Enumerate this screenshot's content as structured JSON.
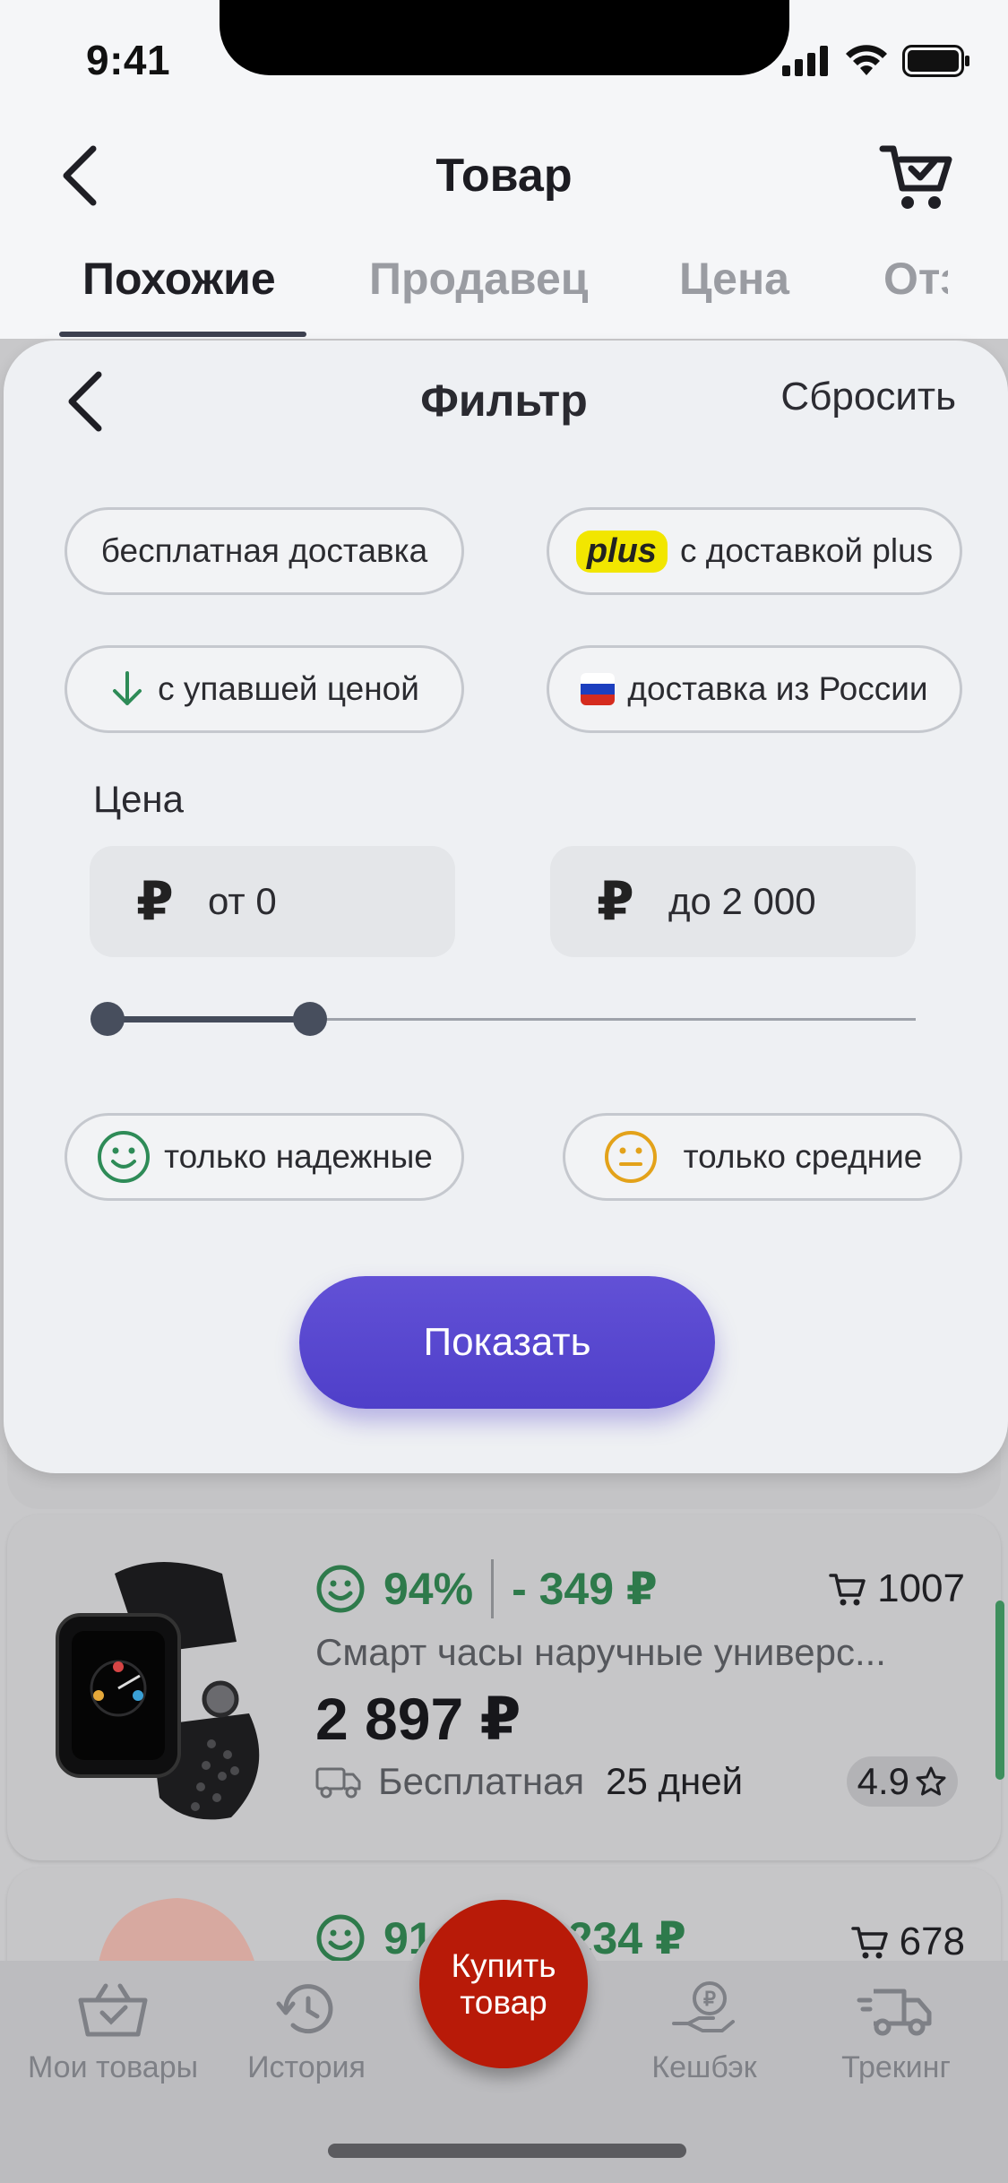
{
  "status_bar": {
    "time": "9:41"
  },
  "header": {
    "title": "Товар"
  },
  "tabs": [
    {
      "label": "Похожие",
      "active": true
    },
    {
      "label": "Продавец",
      "active": false
    },
    {
      "label": "Цена",
      "active": false
    },
    {
      "label": "Отз",
      "active": false
    }
  ],
  "filter": {
    "title": "Фильтр",
    "reset_label": "Сбросить",
    "chips": {
      "free_delivery": "бесплатная доставка",
      "plus_badge": "plus",
      "plus_delivery": "с доставкой plus",
      "price_drop": "с упавшей ценой",
      "from_russia": "доставка из России"
    },
    "price": {
      "label": "Цена",
      "currency": "₽",
      "from": "от 0",
      "to": "до 2 000",
      "slider_min_fraction": 0.0,
      "slider_max_fraction": 0.25
    },
    "reliability": {
      "reliable": "только надежные",
      "average": "только средние"
    },
    "show_button": "Показать"
  },
  "products": [
    {
      "rating_percent": "94%",
      "discount": "- 349 ₽",
      "orders": "1007",
      "name": "Смарт часы наручные универс...",
      "price": "2 897 ₽",
      "delivery": "Бесплатная",
      "delivery_days": "25 дней",
      "stars": "4.9"
    },
    {
      "rating_percent": "91",
      "discount": "234 ₽",
      "orders": "678"
    }
  ],
  "bottom_nav": {
    "my_items": "Мои товары",
    "history": "История",
    "buy": "Купить товар",
    "cashback": "Кешбэк",
    "tracking": "Трекинг"
  },
  "colors": {
    "accent": "#5a49d2",
    "success": "#2e7a4b",
    "warning": "#e3a21a",
    "buy_button": "#b81a08"
  }
}
